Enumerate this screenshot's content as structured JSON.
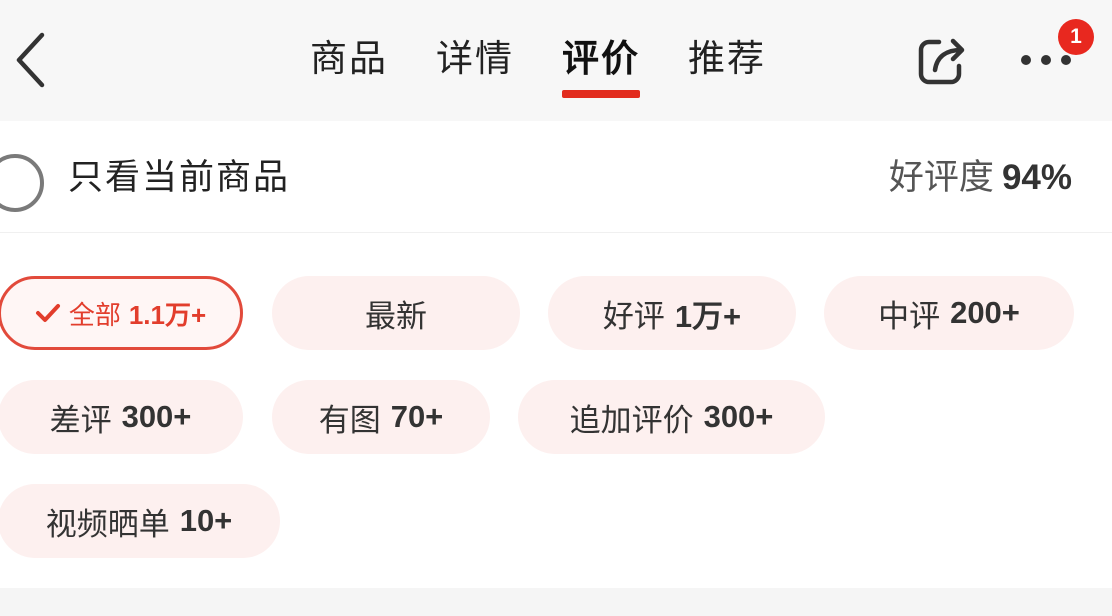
{
  "header": {
    "tabs": [
      {
        "label": "商品",
        "active": false
      },
      {
        "label": "详情",
        "active": false
      },
      {
        "label": "评价",
        "active": true
      },
      {
        "label": "推荐",
        "active": false
      }
    ],
    "badge_count": "1",
    "icons": {
      "back": "chevron-left-icon",
      "share": "share-icon",
      "more": "more-dots-icon"
    }
  },
  "filter": {
    "label": "只看当前商品",
    "rating_label": "好评度",
    "rating_value": "94%"
  },
  "tags": [
    {
      "label": "全部",
      "count": "1.1万+",
      "active": true
    },
    {
      "label": "最新",
      "count": "",
      "active": false
    },
    {
      "label": "好评",
      "count": "1万+",
      "active": false
    },
    {
      "label": "中评",
      "count": "200+",
      "active": false
    },
    {
      "label": "差评",
      "count": "300+",
      "active": false
    },
    {
      "label": "有图",
      "count": "70+",
      "active": false
    },
    {
      "label": "追加评价",
      "count": "300+",
      "active": false
    },
    {
      "label": "视频晒单",
      "count": "10+",
      "active": false
    }
  ],
  "colors": {
    "accent": "#e22c1e",
    "tag_bg": "#fdf0ef",
    "badge": "#e8281f"
  }
}
